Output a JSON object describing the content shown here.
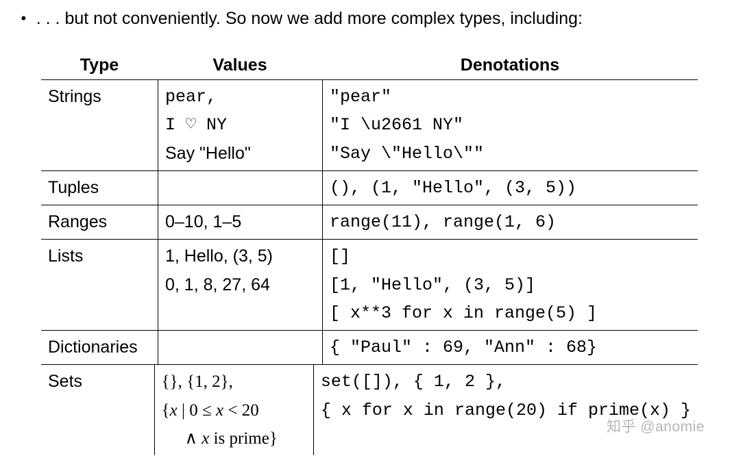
{
  "intro": {
    "bullet": "•",
    "text": ". . . but not conveniently. So now we add more complex types, including:"
  },
  "headers": {
    "type": "Type",
    "values": "Values",
    "denotations": "Denotations"
  },
  "rows": {
    "strings": {
      "type": "Strings",
      "values_l1": "pear,",
      "values_l2": "I ♡ NY",
      "values_l3": "Say \"Hello\"",
      "den_l1": "\"pear\"",
      "den_l2": "\"I \\u2661 NY\"",
      "den_l3": "\"Say \\\"Hello\\\"\""
    },
    "tuples": {
      "type": "Tuples",
      "values": "",
      "den": "(), (1, \"Hello\", (3, 5))"
    },
    "ranges": {
      "type": "Ranges",
      "values": "0–10, 1–5",
      "den": "range(11), range(1, 6)"
    },
    "lists": {
      "type": "Lists",
      "values_l1": "",
      "values_l2": "1, Hello, (3, 5)",
      "values_l3": "0, 1, 8, 27, 64",
      "den_l1": "[]",
      "den_l2": "[1, \"Hello\", (3, 5)]",
      "den_l3": "[ x**3 for x in range(5) ]"
    },
    "dicts": {
      "type": "Dictionaries",
      "values": "",
      "den": "{ \"Paul\" : 69, \"Ann\" : 68}"
    },
    "sets": {
      "type": "Sets",
      "values_l1_a": "{}, {1, 2},",
      "values_l2_prefix": "{",
      "values_l2_x": "x",
      "values_l2_bar": " | ",
      "values_l2_rel": "0 ≤ ",
      "values_l2_x2": "x",
      "values_l2_lt": " < 20",
      "values_l3_and": "∧ ",
      "values_l3_x": "x",
      "values_l3_rest": " is prime}",
      "den_l1": "set([]), { 1, 2 },",
      "den_l2": "{ x for x in range(20) if prime(x) }"
    }
  },
  "watermark": "知乎 @anomie"
}
